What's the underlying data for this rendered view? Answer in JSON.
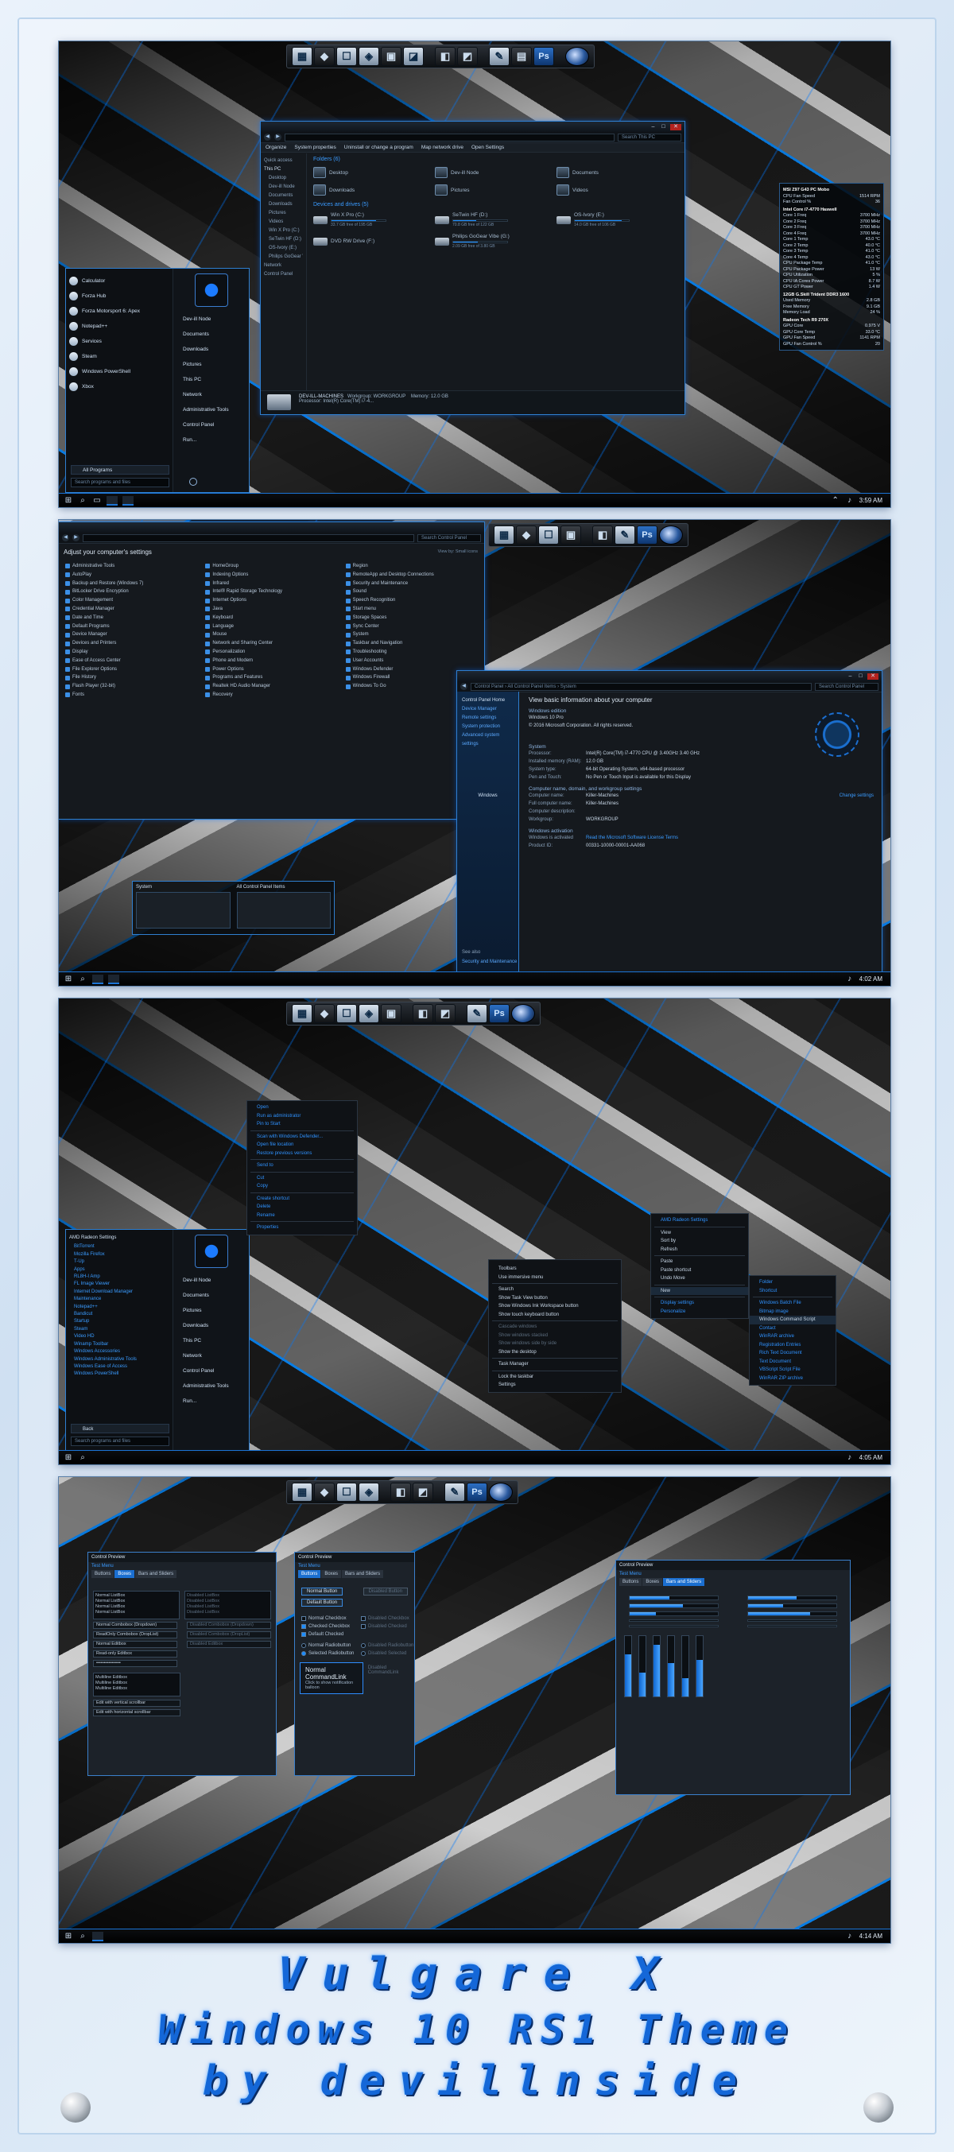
{
  "dock": {
    "ps_label": "Ps"
  },
  "explorer": {
    "ribbon": [
      "Organize",
      "System properties",
      "Uninstall or change a program",
      "Map network drive",
      "Open Settings"
    ],
    "search_placeholder": "Search This PC",
    "nav": [
      "Quick access",
      "This PC",
      "Desktop",
      "Dev-ill Node",
      "Documents",
      "Downloads",
      "Pictures",
      "Videos",
      "Win X Pro (C:)",
      "SeTwin HF (D:)",
      "OS-Ivory (E:)",
      "Philips GoGear Vibe",
      "Network",
      "Control Panel"
    ],
    "folders_header": "Folders (6)",
    "folders": [
      "Desktop",
      "Dev-ill Node",
      "Documents",
      "Downloads",
      "Pictures",
      "Videos"
    ],
    "drives_header": "Devices and drives (5)",
    "drives": [
      {
        "name": "Win X Pro (C:)",
        "info": "33.7 GB free of 195 GB",
        "fill": 0.83
      },
      {
        "name": "SeTwin HF (D:)",
        "info": "70.8 GB free of 122 GB",
        "fill": 0.42
      },
      {
        "name": "OS-Ivory (E:)",
        "info": "14.0 GB free of 106 GB",
        "fill": 0.87
      },
      {
        "name": "DVD RW Drive (F:)",
        "info": "",
        "fill": 0
      },
      {
        "name": "Philips GoGear Vibe (G:)",
        "info": "2.09 GB free of 3.80 GB",
        "fill": 0.45
      }
    ],
    "details": {
      "pc": "DEV-ILL-MACHINES",
      "workgroup_label": "Workgroup:",
      "workgroup": "WORKGROUP",
      "memory_label": "Memory:",
      "memory": "12.0 GB",
      "processor_label": "Processor:",
      "processor": "Intel(R) Core(TM) i7-4..."
    }
  },
  "start1": {
    "apps": [
      "Calculator",
      "Forza Hub",
      "Forza Motorsport 6: Apex",
      "Notepad++",
      "Services",
      "Steam",
      "Windows PowerShell",
      "Xbox"
    ],
    "places": [
      "Dev-ill Node",
      "Documents",
      "Downloads",
      "Pictures",
      "This PC",
      "Network",
      "Administrative Tools",
      "Control Panel",
      "Run..."
    ],
    "all_programs": "All Programs",
    "search": "Search programs and files"
  },
  "gadget": {
    "rows": [
      [
        "MSI Z97 G43 PC Mobo",
        ""
      ],
      [
        "CPU Fan Speed",
        "1514 RPM"
      ],
      [
        "Fan Control %",
        "36"
      ],
      [
        "Intel Core i7-4770 Haswell",
        ""
      ],
      [
        "Core 1 Freq",
        "3700 MHz"
      ],
      [
        "Core 2 Freq",
        "3700 MHz"
      ],
      [
        "Core 3 Freq",
        "3700 MHz"
      ],
      [
        "Core 4 Freq",
        "3700 MHz"
      ],
      [
        "Core 1 Temp",
        "43.0 °C"
      ],
      [
        "Core 2 Temp",
        "40.0 °C"
      ],
      [
        "Core 3 Temp",
        "41.0 °C"
      ],
      [
        "Core 4 Temp",
        "43.0 °C"
      ],
      [
        "CPU Package Temp",
        "41.0 °C"
      ],
      [
        "CPU Package Power",
        "13 W"
      ],
      [
        "CPU Utilization",
        "5 %"
      ],
      [
        "CPU IA Cores Power",
        "8.7 W"
      ],
      [
        "CPU GT Power",
        "1.4 W"
      ],
      [
        "12GB G.Skill Trident DDR3 1600",
        ""
      ],
      [
        "Used Memory",
        "2.8 GB"
      ],
      [
        "Free Memory",
        "9.1 GB"
      ],
      [
        "Memory Load",
        "24 %"
      ],
      [
        "Radeon Tech R9 270X",
        ""
      ],
      [
        "GPU Core",
        "0.975 V"
      ],
      [
        "GPU Core Temp",
        "33.0 °C"
      ],
      [
        "GPU Fan Speed",
        "1141 RPM"
      ],
      [
        "GPU Fan Control %",
        "20"
      ]
    ]
  },
  "clock1": "3:59 AM",
  "clock2": "4:02 AM",
  "clock3": "4:05 AM",
  "clock4": "4:14 AM",
  "cp": {
    "search": "Search Control Panel",
    "heading": "Adjust your computer's settings",
    "view_by": "View by: Small icons",
    "items": [
      "Administrative Tools",
      "AutoPlay",
      "Backup and Restore (Windows 7)",
      "BitLocker Drive Encryption",
      "Color Management",
      "Credential Manager",
      "Date and Time",
      "Default Programs",
      "Device Manager",
      "Devices and Printers",
      "Display",
      "Ease of Access Center",
      "File Explorer Options",
      "File History",
      "Flash Player (32-bit)",
      "Fonts",
      "HomeGroup",
      "Indexing Options",
      "Infrared",
      "Intel® Rapid Storage Technology",
      "Internet Options",
      "Java",
      "Keyboard",
      "Language",
      "Mouse",
      "Network and Sharing Center",
      "Personalization",
      "Phone and Modem",
      "Power Options",
      "Programs and Features",
      "Realtek HD Audio Manager",
      "Recovery",
      "Region",
      "RemoteApp and Desktop Connections",
      "Security and Maintenance",
      "Sound",
      "Speech Recognition",
      "Start menu",
      "Storage Spaces",
      "Sync Center",
      "System",
      "Taskbar and Navigation",
      "Troubleshooting",
      "User Accounts",
      "Windows Defender",
      "Windows Firewall",
      "Windows To Go"
    ],
    "thumbs": [
      "System",
      "All Control Panel Items"
    ]
  },
  "sys": {
    "crumb": [
      "Control Panel",
      "All Control Panel Items",
      "System"
    ],
    "search": "Search Control Panel",
    "side": [
      "Control Panel Home",
      "Device Manager",
      "Remote settings",
      "System protection",
      "Advanced system settings"
    ],
    "see_also": "See also",
    "see_also_item": "Security and Maintenance",
    "title": "View basic information about your computer",
    "edition_h": "Windows edition",
    "edition": "Windows 10 Pro",
    "copyright": "© 2016 Microsoft Corporation. All rights reserved.",
    "system_h": "System",
    "system_rows": [
      [
        "Processor:",
        "Intel(R) Core(TM) i7-4770 CPU @ 3.40GHz  3.40 GHz"
      ],
      [
        "Installed memory (RAM):",
        "12.0 GB"
      ],
      [
        "System type:",
        "64-bit Operating System, x64-based processor"
      ],
      [
        "Pen and Touch:",
        "No Pen or Touch Input is available for this Display"
      ]
    ],
    "name_h": "Computer name, domain, and workgroup settings",
    "name_rows": [
      [
        "Computer name:",
        "Killer-Machines"
      ],
      [
        "Full computer name:",
        "Killer-Machines"
      ],
      [
        "Computer description:",
        ""
      ],
      [
        "Workgroup:",
        "WORKGROUP"
      ]
    ],
    "change": "Change settings",
    "act_h": "Windows activation",
    "act_row": [
      "Windows is activated",
      "Read the Microsoft Software License Terms"
    ],
    "pid": [
      "Product ID:",
      "00331-10000-00001-AA068"
    ],
    "windows_label": "Windows"
  },
  "start3": {
    "header": "AMD Radeon Settings",
    "apps": [
      "BitTorrent",
      "Mozilla Firefox",
      "T-Up",
      "Apps",
      "RL8H-I Amp",
      "FL Image Viewer",
      "Internet Download Manager",
      "Maintenance",
      "Notepad++",
      "Bandicut",
      "Startup",
      "Steam",
      "Video HD",
      "Winamp Toolbar",
      "Windows Accessories",
      "Windows Administrative Tools",
      "Windows Ease of Access",
      "Windows PowerShell"
    ],
    "back": "Back",
    "places": [
      "Dev-ill Node",
      "Documents",
      "Pictures",
      "Downloads",
      "This PC",
      "Network",
      "Control Panel",
      "Administrative Tools",
      "Run..."
    ],
    "search": "Search programs and files"
  },
  "ctx_file": [
    "Open",
    "Run as administrator",
    "Pin to Start",
    "Scan with Windows Defender...",
    "Open file location",
    "Restore previous versions",
    "Send to",
    "Cut",
    "Copy",
    "Create shortcut",
    "Delete",
    "Rename",
    "Properties"
  ],
  "ctx_task": [
    "Toolbars",
    "Use immersive menu",
    "Search",
    "Show Task View button",
    "Show Windows Ink Workspace button",
    "Show touch keyboard button",
    "Cascade windows",
    "Show windows stacked",
    "Show windows side by side",
    "Show the desktop",
    "Task Manager",
    "Lock the taskbar",
    "Settings"
  ],
  "ctx_desk": [
    "AMD Radeon Settings",
    "View",
    "Sort by",
    "Refresh",
    "Paste",
    "Paste shortcut",
    "Undo Move",
    "New",
    "Display settings",
    "Personalize"
  ],
  "ctx_new": [
    "Folder",
    "Shortcut",
    "Windows Batch File",
    "Bitmap image",
    "Windows Command Script",
    "Contact",
    "WinRAR archive",
    "Registration Entries",
    "Rich Text Document",
    "Text Document",
    "VBScript Script File",
    "WinRAR ZIP archive"
  ],
  "cprev": {
    "title": "Control Preview",
    "sub": "Test Menu",
    "tabs": [
      "Buttons",
      "Boxes",
      "Bars and Sliders"
    ],
    "p1": {
      "list": [
        "Normal ListBox",
        "Normal ListBox",
        "Normal ListBox",
        "Normal ListBox"
      ],
      "list_d": [
        "Disabled ListBox",
        "Disabled ListBox",
        "Disabled ListBox",
        "Disabled ListBox"
      ],
      "rows": [
        "Normal Combobox (Dropdown)",
        "ReadOnly Combobox (DropList)",
        "Normal Editbox",
        "Read-only Editbox",
        "••••••••••••••••",
        "Multiline Editbox",
        "Multiline Editbox",
        "Multiline Editbox",
        "Edit with vertical scrollbar",
        "Edit with horizontal scrollbar"
      ],
      "rows_d": [
        "Disabled Combobox (Dropdown)",
        "Disabled Combobox (DropList)",
        "Disabled Editbox"
      ]
    },
    "p2": {
      "btn_normal": "Normal Button",
      "btn_default": "Default Button",
      "btn_disabled": "Disabled Button",
      "checks": [
        "Normal Checkbox",
        "Checked Checkbox",
        "Default Checked",
        "Normal Radiobutton",
        "Selected Radiobutton"
      ],
      "checks_d": [
        "Disabled Checkbox",
        "Disabled Checked",
        "Disabled Radiobutton",
        "Disabled Selected"
      ],
      "cmd_title": "Normal CommandLink",
      "cmd_desc": "Click to show notification balloon",
      "cmd_disabled": "Disabled CommandLink"
    },
    "p3": {
      "bars": [
        0.45,
        0.6,
        0.3
      ],
      "vbars": [
        0.7,
        0.4,
        0.85,
        0.55,
        0.3,
        0.6
      ]
    }
  },
  "credits": {
    "l1": "Vulgare X",
    "l2": "Windows 10 RS1 Theme",
    "l3": "by devillnside"
  }
}
